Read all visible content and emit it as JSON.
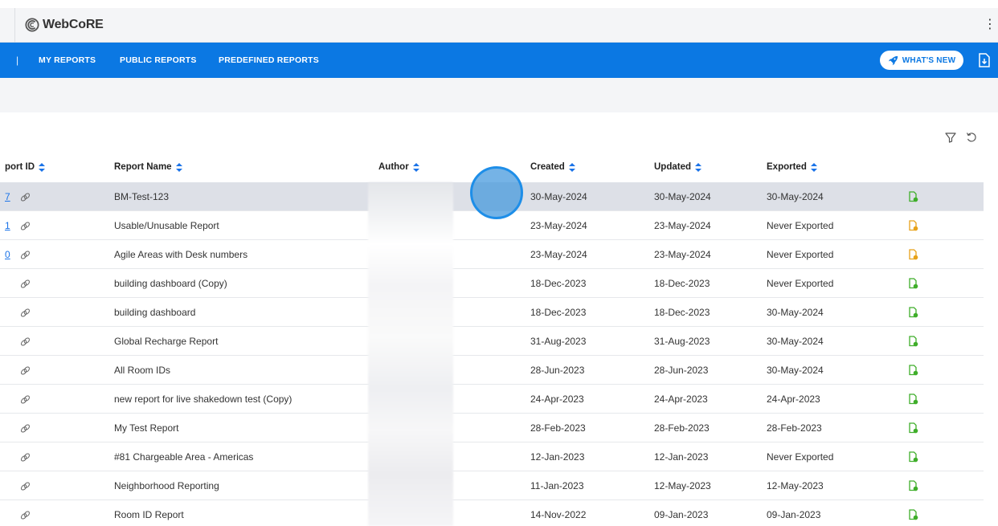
{
  "app": {
    "brand": "WebCoRE",
    "logo_icon": "webcore-logo-icon"
  },
  "nav": {
    "separator": "|",
    "tabs": [
      {
        "label": "MY REPORTS"
      },
      {
        "label": "PUBLIC REPORTS"
      },
      {
        "label": "PREDEFINED REPORTS"
      }
    ],
    "whats_new": "WHAT'S NEW"
  },
  "table": {
    "columns": {
      "id": "port ID",
      "name": "Report Name",
      "author": "Author",
      "created": "Created",
      "updated": "Updated",
      "exported": "Exported"
    },
    "rows": [
      {
        "id": "7",
        "name": "BM-Test-123",
        "created": "30-May-2024",
        "updated": "30-May-2024",
        "exported": "30-May-2024",
        "status": "green"
      },
      {
        "id": "1",
        "name": "Usable/Unusable Report",
        "created": "23-May-2024",
        "updated": "23-May-2024",
        "exported": "Never Exported",
        "status": "orange"
      },
      {
        "id": "0",
        "name": "Agile Areas with Desk numbers",
        "created": "23-May-2024",
        "updated": "23-May-2024",
        "exported": "Never Exported",
        "status": "orange"
      },
      {
        "id": "",
        "name": "building dashboard (Copy)",
        "created": "18-Dec-2023",
        "updated": "18-Dec-2023",
        "exported": "Never Exported",
        "status": "green"
      },
      {
        "id": "",
        "name": "building dashboard",
        "created": "18-Dec-2023",
        "updated": "18-Dec-2023",
        "exported": "30-May-2024",
        "status": "green"
      },
      {
        "id": "",
        "name": "Global Recharge Report",
        "created": "31-Aug-2023",
        "updated": "31-Aug-2023",
        "exported": "30-May-2024",
        "status": "green"
      },
      {
        "id": "",
        "name": "All Room IDs",
        "created": "28-Jun-2023",
        "updated": "28-Jun-2023",
        "exported": "30-May-2024",
        "status": "green"
      },
      {
        "id": "",
        "name": "new report for live shakedown test (Copy)",
        "created": "24-Apr-2023",
        "updated": "24-Apr-2023",
        "exported": "24-Apr-2023",
        "status": "green"
      },
      {
        "id": "",
        "name": "My Test Report",
        "created": "28-Feb-2023",
        "updated": "28-Feb-2023",
        "exported": "28-Feb-2023",
        "status": "green"
      },
      {
        "id": "",
        "name": "#81 Chargeable Area - Americas",
        "created": "12-Jan-2023",
        "updated": "12-Jan-2023",
        "exported": "Never Exported",
        "status": "green"
      },
      {
        "id": "",
        "name": "Neighborhood Reporting",
        "created": "11-Jan-2023",
        "updated": "12-May-2023",
        "exported": "12-May-2023",
        "status": "green"
      },
      {
        "id": "",
        "name": "Room ID Report",
        "created": "14-Nov-2022",
        "updated": "09-Jan-2023",
        "exported": "09-Jan-2023",
        "status": "green"
      }
    ]
  },
  "colors": {
    "primary": "#0b78e3",
    "sort": "#1a73e8",
    "status_green": "#3fae2a",
    "status_orange": "#e7a21a"
  }
}
